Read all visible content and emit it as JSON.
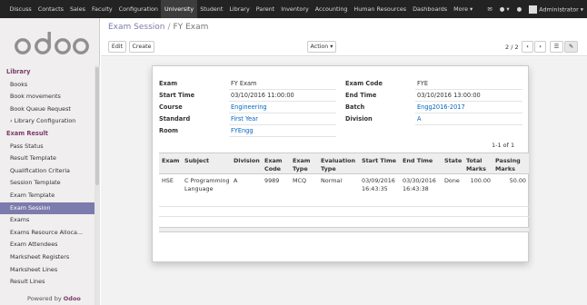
{
  "topmenu": [
    "Discuss",
    "Contacts",
    "Sales",
    "Faculty",
    "Configuration",
    "University",
    "Student",
    "Library",
    "Parent",
    "Inventory",
    "Accounting",
    "Human Resources",
    "Dashboards",
    "More ▾"
  ],
  "topbar_right": {
    "user": "Administrator ▾"
  },
  "sidebar": {
    "logo": "odoo",
    "sections": [
      {
        "title": "Library",
        "items": [
          "Books",
          "Book movements",
          "Book Queue Request",
          "› Library Configuration"
        ]
      },
      {
        "title": "Exam Result",
        "items": [
          "Pass Status",
          "Result Template",
          "Qualification Criteria",
          "Session Template",
          "Exam Template",
          "Exam Session",
          "Exams",
          "Exams Resource Alloca...",
          "Exam Attendees",
          "Marksheet Registers",
          "Marksheet Lines",
          "Result Lines"
        ]
      }
    ],
    "active_item": "Exam Session",
    "powered_by": "Powered by",
    "powered_brand": "Odoo"
  },
  "breadcrumb": {
    "parent": "Exam Session",
    "separator": "/",
    "current": "FY Exam"
  },
  "buttons": {
    "edit": "Edit",
    "create": "Create",
    "action": "Action ▾"
  },
  "pager": {
    "text": "2 / 2",
    "prev": "‹",
    "next": "›"
  },
  "form": {
    "left": [
      {
        "label": "Exam",
        "value": "FY Exam",
        "link": false
      },
      {
        "label": "Start Time",
        "value": "03/10/2016 11:00:00",
        "link": false
      },
      {
        "label": "Course",
        "value": "Engineering",
        "link": true
      },
      {
        "label": "Standard",
        "value": "First Year",
        "link": true
      },
      {
        "label": "Room",
        "value": "FYEngg",
        "link": true
      }
    ],
    "right": [
      {
        "label": "Exam Code",
        "value": "FYE",
        "link": false
      },
      {
        "label": "End Time",
        "value": "03/10/2016 13:00:00",
        "link": false
      },
      {
        "label": "Batch",
        "value": "Engg2016-2017",
        "link": true
      },
      {
        "label": "Division",
        "value": "A",
        "link": true
      }
    ]
  },
  "list_pager": "1-1 of 1",
  "table": {
    "headers": [
      [
        "Exam"
      ],
      [
        "Subject"
      ],
      [
        "Division"
      ],
      [
        "Exam",
        "Code"
      ],
      [
        "Exam",
        "Type"
      ],
      [
        "Evaluation",
        "Type"
      ],
      [
        "Start Time"
      ],
      [
        "End Time"
      ],
      [
        "State"
      ],
      [
        "Total",
        "Marks"
      ],
      [
        "Passing",
        "Marks"
      ]
    ],
    "rows": [
      [
        [
          "HSE"
        ],
        [
          "C Programming",
          "Language"
        ],
        [
          "A"
        ],
        [
          "9989"
        ],
        [
          "MCQ"
        ],
        [
          "Normal"
        ],
        [
          "03/09/2016",
          "16:43:35"
        ],
        [
          "03/30/2016",
          "16:43:38"
        ],
        [
          "Done"
        ],
        [
          "100.00"
        ],
        [
          "50.00"
        ]
      ]
    ]
  },
  "colors": {
    "accent": "#7c7bad",
    "brand": "#7c3b6b",
    "link": "#0066c0",
    "topbar": "#232323"
  }
}
